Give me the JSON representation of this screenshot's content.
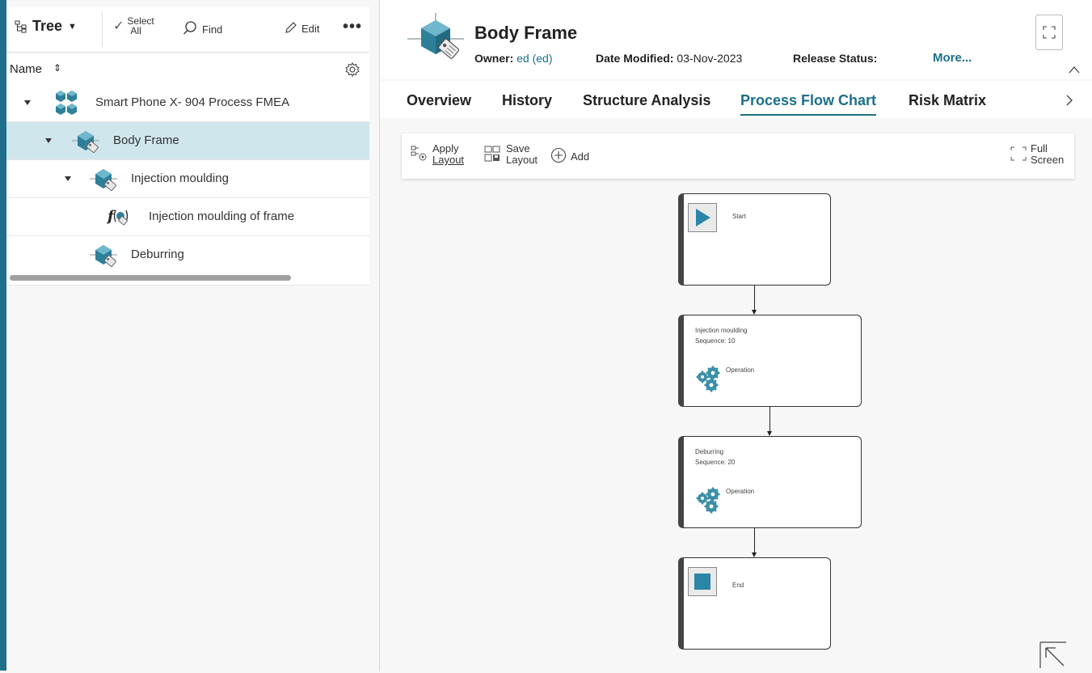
{
  "left_toolbar": {
    "tree_label": "Tree",
    "select_top": "Select",
    "select_bottom": "All",
    "find_label": "Find",
    "edit_label": "Edit"
  },
  "tree_header": {
    "name_label": "Name"
  },
  "tree_rows": [
    {
      "label": "Smart Phone X- 904 Process FMEA",
      "icon": "cluster-icon",
      "expanded": true
    },
    {
      "label": "Body Frame",
      "icon": "process-item-icon",
      "expanded": true,
      "selected": true
    },
    {
      "label": "Injection moulding",
      "icon": "process-item-icon",
      "expanded": true
    },
    {
      "label": "Injection moulding of frame",
      "icon": "function-icon"
    },
    {
      "label": "Deburring",
      "icon": "process-item-icon"
    }
  ],
  "object": {
    "title": "Body Frame",
    "owner_label": "Owner:",
    "owner_value": "ed (ed)",
    "date_label": "Date Modified:",
    "date_value": "03-Nov-2023",
    "release_label": "Release Status:",
    "more_label": "More..."
  },
  "tabs": [
    "Overview",
    "History",
    "Structure Analysis",
    "Process Flow Chart",
    "Risk Matrix"
  ],
  "active_tab": "Process Flow Chart",
  "canvas_toolbar": {
    "apply_top": "Apply",
    "apply_bottom": "Layout",
    "save_top": "Save",
    "save_bottom": "Layout",
    "add_label": "Add",
    "full_top": "Full",
    "full_bottom": "Screen"
  },
  "flow": {
    "start_label": "Start",
    "op1_name": "Injection moulding",
    "op1_seq": "Sequence:  10",
    "op1_type": "Operation",
    "op2_name": "Deburring",
    "op2_seq": "Sequence:  20",
    "op2_type": "Operation",
    "end_label": "End"
  },
  "colors": {
    "accent": "#1b6f8a",
    "selected_row": "#cfe6ec",
    "left_bar": "#1f6e8c"
  }
}
